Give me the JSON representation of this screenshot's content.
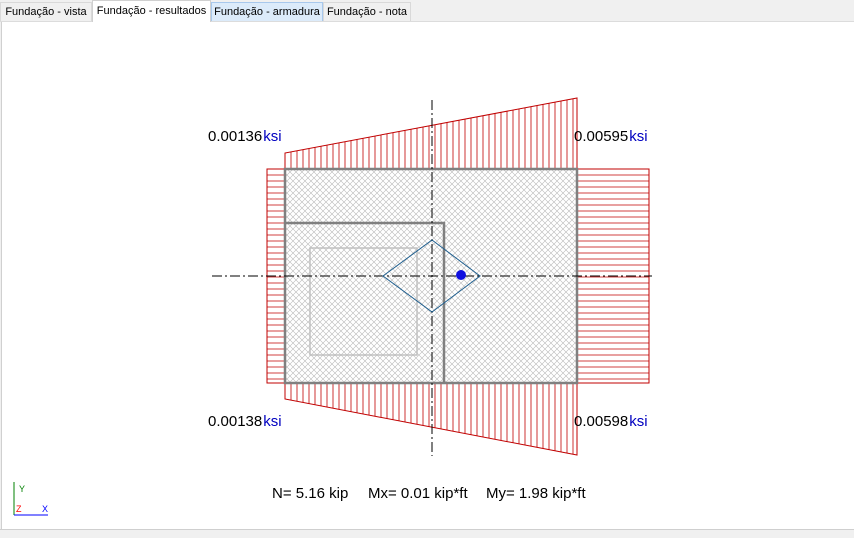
{
  "tabs": [
    {
      "label": "Fundação - vista"
    },
    {
      "label": "Fundação - resultados"
    },
    {
      "label": "Fundação - armadura"
    },
    {
      "label": "Fundação - nota"
    }
  ],
  "active_tab": "Fundação - resultados",
  "stress_labels": {
    "top_left": {
      "value": "0.00136",
      "unit": "ksi"
    },
    "top_right": {
      "value": "0.00595",
      "unit": "ksi"
    },
    "bottom_left": {
      "value": "0.00138",
      "unit": "ksi"
    },
    "bottom_right": {
      "value": "0.00598",
      "unit": "ksi"
    }
  },
  "results": {
    "n": "N= 5.16 kip",
    "mx": "Mx= 0.01 kip*ft",
    "my": "My= 1.98 kip*ft"
  },
  "axes": {
    "y": "Y",
    "z": "Z",
    "x": "X"
  },
  "colors": {
    "stress_lines": "#c00000",
    "unit_text": "#0000c0",
    "axis_y": "#008000",
    "axis_x": "#0000ff",
    "axis_z": "#ff0000",
    "load_point": "#1010e0",
    "kern": "#1f5f8f"
  }
}
